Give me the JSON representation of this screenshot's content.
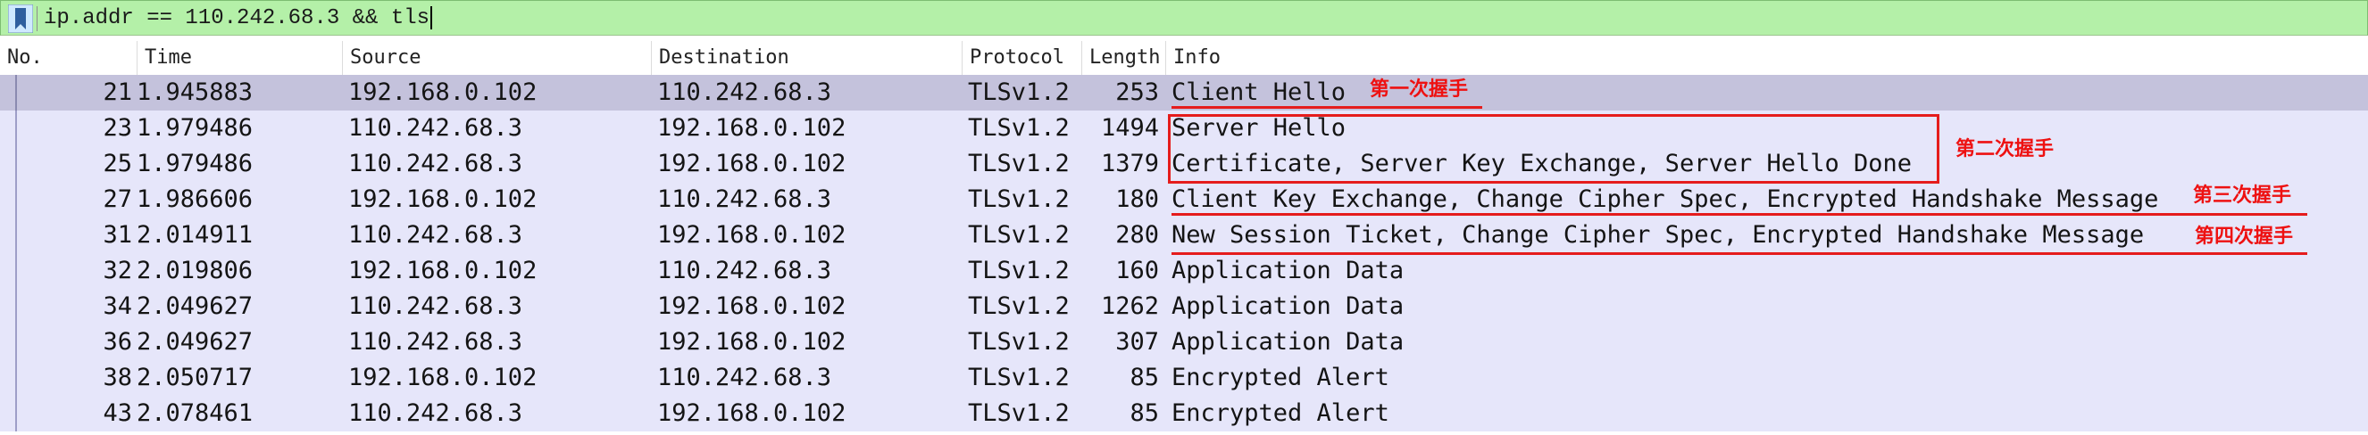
{
  "filter": {
    "value": "ip.addr == 110.242.68.3 && tls"
  },
  "columns": [
    "No.",
    "Time",
    "Source",
    "Destination",
    "Protocol",
    "Length",
    "Info"
  ],
  "packets": [
    {
      "no": "21",
      "time": "1.945883",
      "source": "192.168.0.102",
      "destination": "110.242.68.3",
      "protocol": "TLSv1.2",
      "length": "253",
      "info": "Client Hello"
    },
    {
      "no": "23",
      "time": "1.979486",
      "source": "110.242.68.3",
      "destination": "192.168.0.102",
      "protocol": "TLSv1.2",
      "length": "1494",
      "info": "Server Hello"
    },
    {
      "no": "25",
      "time": "1.979486",
      "source": "110.242.68.3",
      "destination": "192.168.0.102",
      "protocol": "TLSv1.2",
      "length": "1379",
      "info": "Certificate, Server Key Exchange, Server Hello Done"
    },
    {
      "no": "27",
      "time": "1.986606",
      "source": "192.168.0.102",
      "destination": "110.242.68.3",
      "protocol": "TLSv1.2",
      "length": "180",
      "info": "Client Key Exchange, Change Cipher Spec, Encrypted Handshake Message"
    },
    {
      "no": "31",
      "time": "2.014911",
      "source": "110.242.68.3",
      "destination": "192.168.0.102",
      "protocol": "TLSv1.2",
      "length": "280",
      "info": "New Session Ticket, Change Cipher Spec, Encrypted Handshake Message"
    },
    {
      "no": "32",
      "time": "2.019806",
      "source": "192.168.0.102",
      "destination": "110.242.68.3",
      "protocol": "TLSv1.2",
      "length": "160",
      "info": "Application Data"
    },
    {
      "no": "34",
      "time": "2.049627",
      "source": "110.242.68.3",
      "destination": "192.168.0.102",
      "protocol": "TLSv1.2",
      "length": "1262",
      "info": "Application Data"
    },
    {
      "no": "36",
      "time": "2.049627",
      "source": "110.242.68.3",
      "destination": "192.168.0.102",
      "protocol": "TLSv1.2",
      "length": "307",
      "info": "Application Data"
    },
    {
      "no": "38",
      "time": "2.050717",
      "source": "192.168.0.102",
      "destination": "110.242.68.3",
      "protocol": "TLSv1.2",
      "length": "85",
      "info": "Encrypted Alert"
    },
    {
      "no": "43",
      "time": "2.078461",
      "source": "110.242.68.3",
      "destination": "192.168.0.102",
      "protocol": "TLSv1.2",
      "length": "85",
      "info": "Encrypted Alert"
    }
  ],
  "selected_row": 0,
  "annotations": {
    "first": "第一次握手",
    "second": "第二次握手",
    "third": "第三次握手",
    "fourth": "第四次握手"
  },
  "colors": {
    "filter_bg": "#b4f0a8",
    "row_bg": "#e6e6fa",
    "selected_bg": "#c4c2dc",
    "annotation": "#e51c1c"
  }
}
